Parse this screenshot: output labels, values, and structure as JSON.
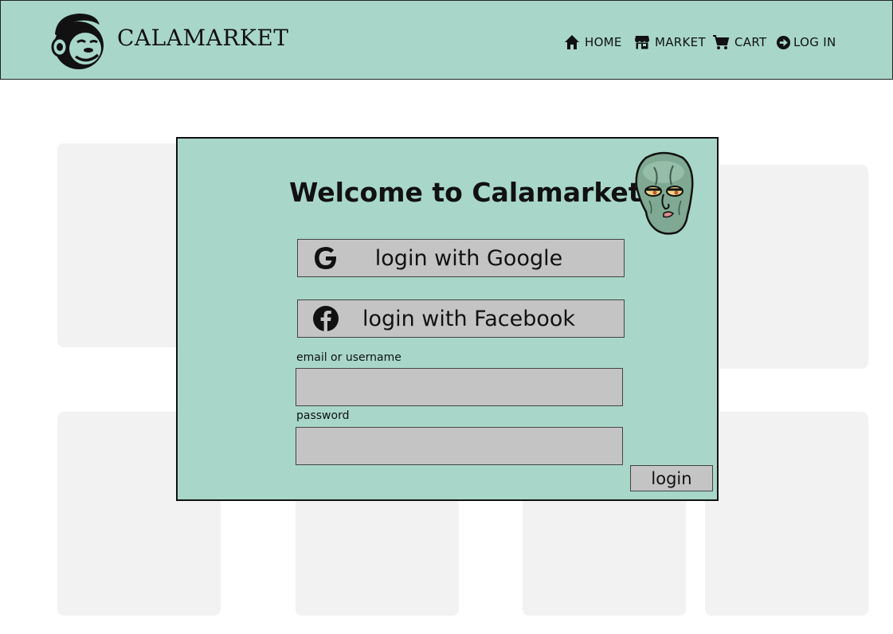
{
  "brand": {
    "name": "CALAMARKET",
    "logo_icon": "monkey-mascot-icon"
  },
  "nav": {
    "items": [
      {
        "label": "HOME",
        "icon": "home-icon"
      },
      {
        "label": "MARKET",
        "icon": "storefront-icon"
      },
      {
        "label": "CART",
        "icon": "cart-icon"
      },
      {
        "label": "LOG IN",
        "icon": "login-arrow-icon"
      }
    ]
  },
  "modal": {
    "title": "Welcome to Calamarket!",
    "mascot_icon": "squid-face-icon",
    "google_label": "login with Google",
    "facebook_label": "login with Facebook",
    "email_label": "email or username",
    "email_value": "",
    "password_label": "password",
    "password_value": "",
    "submit_label": "login"
  },
  "colors": {
    "header_bg": "#a8d7c9",
    "modal_bg": "#a8d7c9",
    "button_bg": "#c4c4c4",
    "placeholder_card": "#f2f2f2"
  }
}
